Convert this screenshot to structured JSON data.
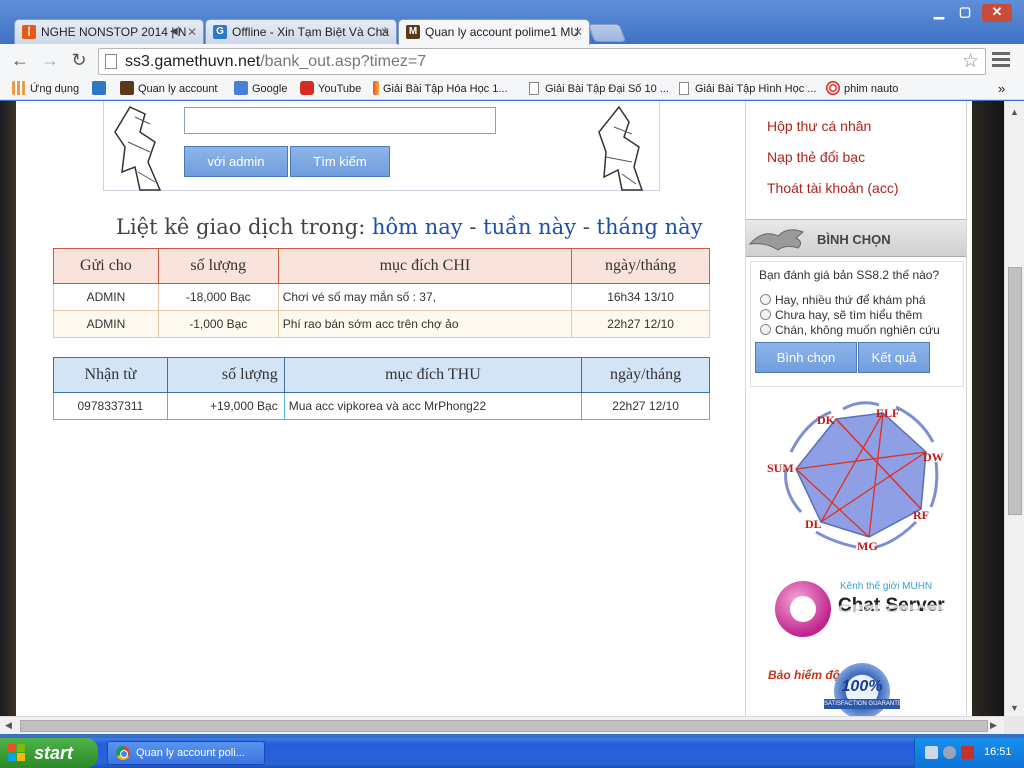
{
  "browser": {
    "tabs": [
      {
        "title": "NGHE NONSTOP 2014 | N",
        "favicon": "youtube-icon",
        "active": false
      },
      {
        "title": "Offline - Xin Tạm Biệt Và Chà",
        "favicon": "g-site-icon",
        "active": false
      },
      {
        "title": "Quan ly account polime1 MU",
        "favicon": "mu-game-icon",
        "active": true
      }
    ],
    "url_host": "ss3.gamethuvn.net",
    "url_path": "/bank_out.asp?timez=7",
    "bookmarks": [
      {
        "label": "Ứng dụng",
        "icon": "apps-grid-icon"
      },
      {
        "label": "",
        "icon": "g-site-icon"
      },
      {
        "label": "Quan ly account",
        "icon": "mu-game-icon"
      },
      {
        "label": "Google",
        "icon": "google-icon"
      },
      {
        "label": "YouTube",
        "icon": "youtube-icon"
      },
      {
        "label": "Giải Bài Tập Hóa Học 1...",
        "icon": "pen-icon"
      },
      {
        "label": "Giải Bài Tập Đại Số 10 ...",
        "icon": "document-icon"
      },
      {
        "label": "Giải Bài Tập Hình Học ...",
        "icon": "document-icon"
      },
      {
        "label": "phim nauto",
        "icon": "swirl-icon"
      }
    ],
    "more_bookmarks": "»"
  },
  "search": {
    "admin_button": "với admin",
    "search_button": "Tìm kiếm"
  },
  "listing": {
    "prefix": "Liệt kê giao dịch trong: ",
    "today": "hôm nay",
    "sep": " - ",
    "week": "tuần này",
    "month": "tháng này"
  },
  "spend_table": {
    "headers": [
      "Gửi cho",
      "số lượng",
      "mục đích CHI",
      "ngày/tháng"
    ],
    "rows": [
      {
        "to": "ADMIN",
        "amount": "-18,000  Bạc",
        "purpose": "Chơi vé số may mắn số : 37,",
        "date": "16h34 13/10"
      },
      {
        "to": "ADMIN",
        "amount": "-1,000  Bạc",
        "purpose": "Phí rao bán sớm acc trên chợ ảo",
        "date": "22h27 12/10"
      }
    ]
  },
  "receive_table": {
    "headers": [
      "Nhận từ",
      "số lượng",
      "mục đích THU",
      "ngày/tháng"
    ],
    "rows": [
      {
        "from": "0978337311",
        "amount": "+19,000  Bạc",
        "purpose": "Mua acc vipkorea và acc MrPhong22",
        "date": "22h27 12/10"
      }
    ]
  },
  "sidebar": {
    "links": [
      "Hộp thư cá nhân",
      "Nạp thẻ đổi bạc",
      "Thoát tài khoản (acc)"
    ],
    "poll_title": "BÌNH CHỌN",
    "poll_question": "Bạn đánh giá bản SS8.2 thế nào?",
    "poll_options": [
      "Hay, nhiều thứ để khám phá",
      "Chưa hay, sẽ tìm hiểu thêm",
      "Chán, không muốn nghiên cứu"
    ],
    "vote_button": "Bình chọn",
    "result_button": "Kết quả",
    "class_labels": [
      "DK",
      "ELF",
      "DW",
      "RF",
      "MG",
      "DL",
      "SUM"
    ],
    "chat_caption": "Kênh thế giới MUHN",
    "chat_title": "Chat Server",
    "insurance_label": "Bảo hiểm độ",
    "insurance_badge": "100%",
    "insurance_ribbon": "SATISFACTION GUARANTEE"
  },
  "taskbar": {
    "start_label": "start",
    "task_item": "Quan ly account poli...",
    "clock": "16:51"
  },
  "colors": {
    "chi_border": "#c95a3f",
    "thu_border": "#3f6ea9",
    "link_blue": "#1d4fa8",
    "sidebar_red": "#b3221a"
  }
}
